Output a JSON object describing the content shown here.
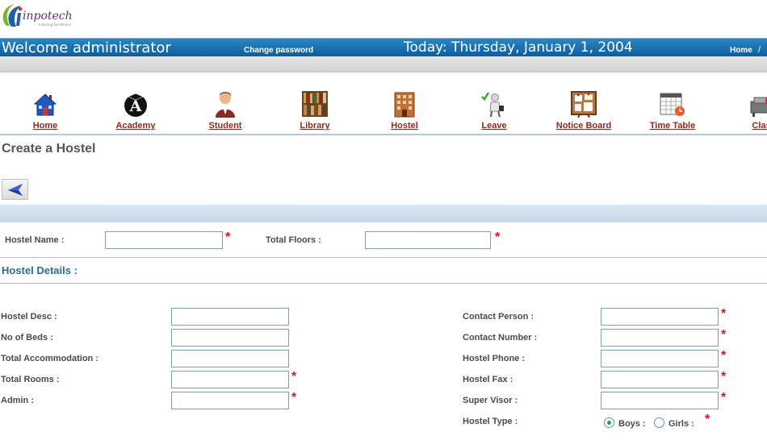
{
  "brand": {
    "name": "inpotech",
    "tagline": "Inducing Excellence"
  },
  "header": {
    "welcome": "Welcome administrator",
    "change_password": "Change password",
    "today": "Today: Thursday, January 1, 2004",
    "home_link": "Home",
    "separator": "/"
  },
  "nav": [
    {
      "label": "Home",
      "icon": "home-icon"
    },
    {
      "label": "Academy",
      "icon": "academy-icon"
    },
    {
      "label": "Student",
      "icon": "student-icon"
    },
    {
      "label": "Library",
      "icon": "library-icon"
    },
    {
      "label": "Hostel",
      "icon": "hostel-icon"
    },
    {
      "label": "Leave",
      "icon": "leave-icon"
    },
    {
      "label": "Notice Board",
      "icon": "notice-board-icon"
    },
    {
      "label": "Time Table",
      "icon": "time-table-icon"
    },
    {
      "label": "Clas",
      "icon": "class-icon"
    }
  ],
  "page": {
    "title": "Create a Hostel",
    "back_icon": "back-arrow-icon"
  },
  "form": {
    "hostel_name": {
      "label": "Hostel Name :",
      "value": "",
      "required": "*"
    },
    "total_floors": {
      "label": "Total Floors :",
      "value": "",
      "required": "*"
    },
    "details_title": "Hostel Details :",
    "left": [
      {
        "label": "Hostel Desc :",
        "value": "",
        "required": ""
      },
      {
        "label": "No of Beds :",
        "value": "",
        "required": ""
      },
      {
        "label": "Total Accommodation :",
        "value": "",
        "required": ""
      },
      {
        "label": "Total Rooms :",
        "value": "",
        "required": "*"
      },
      {
        "label": "Admin :",
        "value": "",
        "required": "*"
      }
    ],
    "right": [
      {
        "label": "Contact Person :",
        "value": "",
        "required": "*"
      },
      {
        "label": "Contact Number :",
        "value": "",
        "required": "*"
      },
      {
        "label": "Hostel Phone :",
        "value": "",
        "required": "*"
      },
      {
        "label": "Hostel Fax :",
        "value": "",
        "required": "*"
      },
      {
        "label": "Super Visor :",
        "value": "",
        "required": "*"
      }
    ],
    "hostel_type": {
      "label": "Hostel Type :",
      "options": [
        "Boys :",
        "Girls :"
      ],
      "selected": "Boys :",
      "required": "*"
    }
  },
  "colors": {
    "header_blue": "#0d5d9b",
    "nav_label": "#8e2a1c",
    "required": "#e0141c",
    "section_title": "#2a6c99"
  }
}
